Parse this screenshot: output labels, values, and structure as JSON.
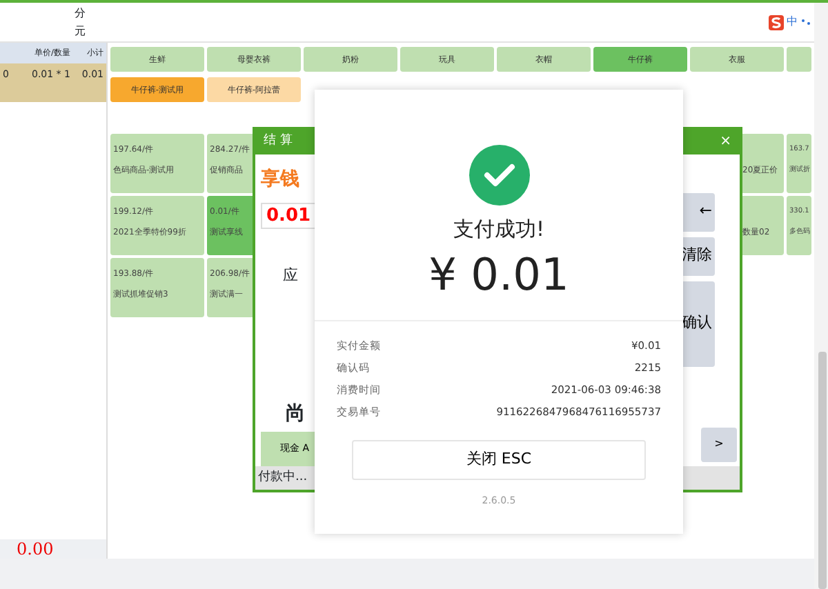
{
  "top_bar": {
    "unit_labels": [
      "分",
      "元"
    ],
    "ime_label": "中"
  },
  "order_table": {
    "columns": [
      "",
      "单价/数量",
      "小计"
    ],
    "rows": [
      {
        "cells": [
          "0",
          "0.01 * 1",
          "0.01"
        ],
        "selected": true
      }
    ]
  },
  "total": "0.00",
  "categories": [
    {
      "label": "生鲜",
      "selected": false
    },
    {
      "label": "母婴衣裤",
      "selected": false
    },
    {
      "label": "奶粉",
      "selected": false
    },
    {
      "label": "玩具",
      "selected": false
    },
    {
      "label": "衣帽",
      "selected": false
    },
    {
      "label": "牛仔裤",
      "selected": true
    },
    {
      "label": "衣服",
      "selected": false
    },
    {
      "selected": false
    }
  ],
  "subcategories": [
    {
      "label": "牛仔裤-测试用",
      "selected": true
    },
    {
      "label": "牛仔裤-阿拉蕾",
      "selected": false
    }
  ],
  "product_rows": [
    {
      "tiles": [
        {
          "price": "197.64/件",
          "name": "色码商品-测试用",
          "selected": false
        },
        {
          "price": "284.27/件",
          "name": "促销商品",
          "selected": false
        }
      ],
      "right_tiles": [
        {
          "name": "20夏正价",
          "selected": false
        },
        {
          "price": "163.7",
          "name": "测试折",
          "selected": false
        }
      ]
    },
    {
      "tiles": [
        {
          "price": "199.12/件",
          "name": "2021全季特价99折",
          "selected": false
        },
        {
          "price": "0.01/件",
          "name": "测试享线",
          "selected": true
        }
      ],
      "right_tiles": [
        {
          "name": "数量02",
          "selected": false
        },
        {
          "price": "330.1",
          "name": "多色码",
          "selected": false
        }
      ]
    },
    {
      "tiles": [
        {
          "price": "193.88/件",
          "name": "测试抓堆促销3",
          "selected": false
        },
        {
          "price": "206.98/件",
          "name": "测试满一",
          "selected": false
        }
      ]
    }
  ],
  "checkout_dialog": {
    "title": "结 算",
    "close": "×",
    "heading": "享钱",
    "amount": "0.01",
    "due_label": "应",
    "remaining_label": "尚",
    "pay_buttons": [
      "现金 A"
    ],
    "keys": [
      {
        "label": "←",
        "kind": "small"
      },
      {
        "label": "清除",
        "kind": "small"
      },
      {
        "label": "确认",
        "kind": "tall"
      }
    ],
    "next": ">",
    "status": "付款中..."
  },
  "success_modal": {
    "title": "支付成功!",
    "amount": "¥ 0.01",
    "details": [
      {
        "label": "实付金额",
        "value": "¥0.01"
      },
      {
        "label": "确认码",
        "value": "2215"
      },
      {
        "label": "消费时间",
        "value": "2021-06-03 09:46:38"
      },
      {
        "label": "交易单号",
        "value": "9116226847968476116955737"
      }
    ],
    "close_button": "关闭 ESC",
    "version": "2.6.0.5"
  }
}
